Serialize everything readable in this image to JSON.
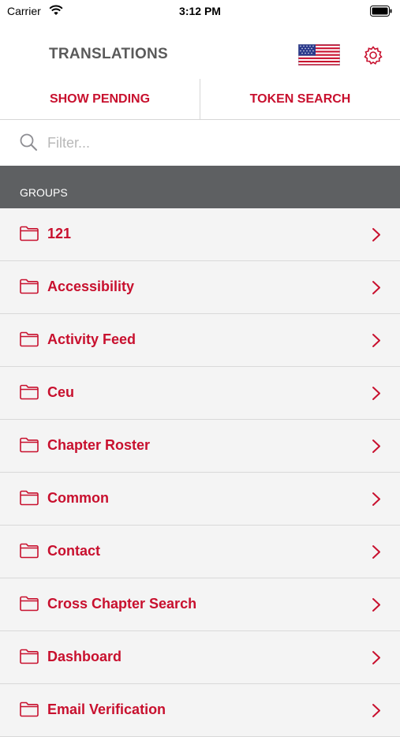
{
  "status_bar": {
    "carrier": "Carrier",
    "time": "3:12 PM"
  },
  "navbar": {
    "title": "TRANSLATIONS",
    "flag_icon": "us-flag-icon",
    "settings_icon": "gear-icon"
  },
  "segments": {
    "show_pending": "SHOW PENDING",
    "token_search": "TOKEN SEARCH"
  },
  "search": {
    "placeholder": "Filter...",
    "value": ""
  },
  "section": {
    "header": "GROUPS"
  },
  "groups": [
    {
      "label": "121"
    },
    {
      "label": "Accessibility"
    },
    {
      "label": "Activity Feed"
    },
    {
      "label": "Ceu"
    },
    {
      "label": "Chapter Roster"
    },
    {
      "label": "Common"
    },
    {
      "label": "Contact"
    },
    {
      "label": "Cross Chapter Search"
    },
    {
      "label": "Dashboard"
    },
    {
      "label": "Email Verification"
    }
  ],
  "colors": {
    "accent": "#c8102e",
    "header_bg": "#5e6062",
    "list_bg": "#f4f4f4",
    "title": "#5a5a5a"
  }
}
